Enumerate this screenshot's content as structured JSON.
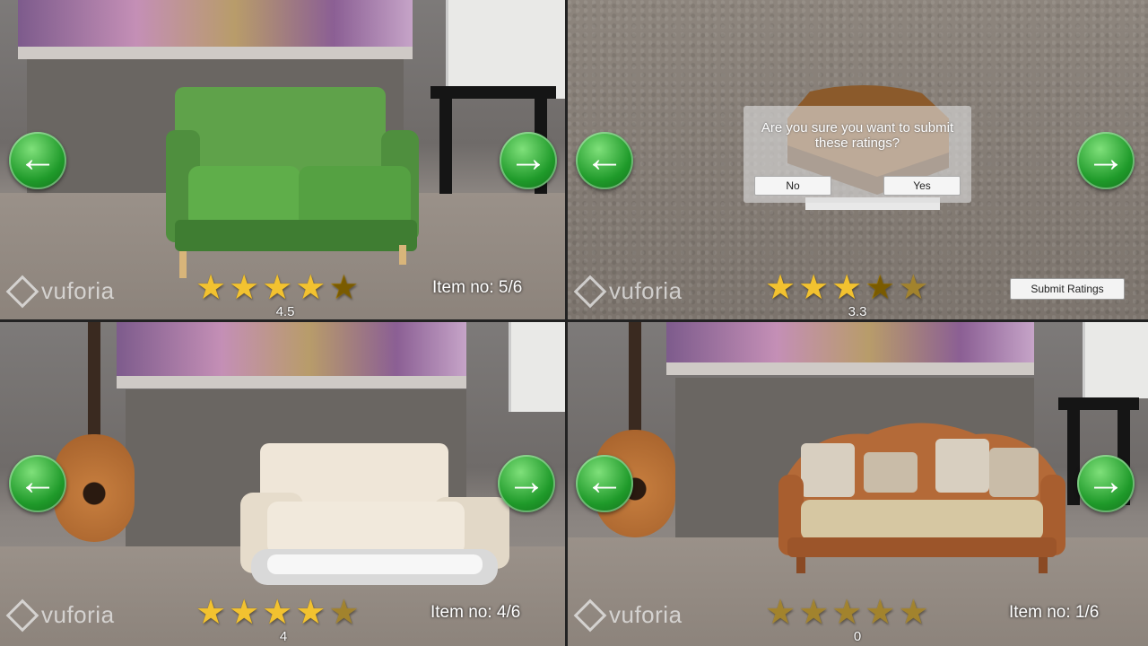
{
  "panels": [
    {
      "item_no": "Item no: 5/6",
      "score": "4.5",
      "rating": 4.5,
      "sofa_color": "#4f8f3e"
    },
    {
      "score": "3.3",
      "rating": 3.3,
      "dialog": {
        "message": "Are you sure you want to submit these ratings?",
        "no_label": "No",
        "yes_label": "Yes"
      },
      "submit_label": "Submit Ratings"
    },
    {
      "item_no": "Item no: 4/6",
      "score": "4",
      "rating": 4,
      "sofa_color": "#e9dfcf"
    },
    {
      "item_no": "Item no: 1/6",
      "score": "0",
      "rating": 0,
      "sofa_color": "#b46a38"
    }
  ],
  "brand": "vuforia",
  "colors": {
    "nav_green": "#1f9a2a",
    "star_gold": "#f2c230"
  },
  "icons": {
    "prev": "arrow-left-icon",
    "next": "arrow-right-icon",
    "star": "star-icon",
    "logo": "vuforia-logo-icon"
  }
}
